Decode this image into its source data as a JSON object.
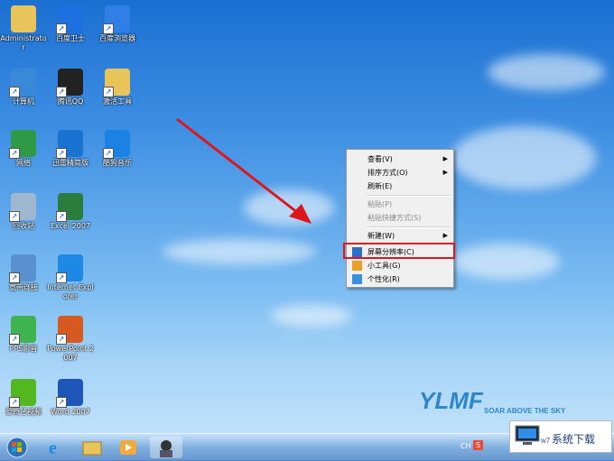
{
  "desktop": {
    "icons": [
      {
        "label": "Administrator",
        "name": "folder-user-icon",
        "color": "#e9c45a"
      },
      {
        "label": "百度卫士",
        "name": "shield-icon",
        "color": "#1e6fe0"
      },
      {
        "label": "百度浏览器",
        "name": "browser-icon",
        "color": "#2f7fe6"
      },
      {
        "label": "计算机",
        "name": "computer-icon",
        "color": "#3a88d8"
      },
      {
        "label": "腾讯QQ",
        "name": "qq-penguin-icon",
        "color": "#222222"
      },
      {
        "label": "激活工具",
        "name": "folder-icon",
        "color": "#e9c45a"
      },
      {
        "label": "网络",
        "name": "network-globe-icon",
        "color": "#2e9a48"
      },
      {
        "label": "迅雷精简版",
        "name": "thunder-bird-icon",
        "color": "#1a73d1"
      },
      {
        "label": "酷狗音乐",
        "name": "kugou-music-icon",
        "color": "#1a82e2"
      },
      {
        "label": "回收站",
        "name": "recycle-bin-icon",
        "color": "#9fb7cf"
      },
      {
        "label": "Excel 2007",
        "name": "excel-icon",
        "color": "#2b7d3e"
      },
      {
        "label": "宽带连接",
        "name": "broadband-connection-icon",
        "color": "#5a8fd0"
      },
      {
        "label": "Internet Explorer",
        "name": "internet-explorer-icon",
        "color": "#1e88e5"
      },
      {
        "label": "PPS影音",
        "name": "pps-player-icon",
        "color": "#3fb34f"
      },
      {
        "label": "PowerPoint 2007",
        "name": "powerpoint-icon",
        "color": "#d65a1f"
      },
      {
        "label": "爱奇艺视频",
        "name": "iqiyi-icon",
        "color": "#53b81f"
      },
      {
        "label": "Word 2007",
        "name": "word-icon",
        "color": "#1e56b8"
      }
    ]
  },
  "context_menu": {
    "items": [
      {
        "label": "查看(V)",
        "submenu": true,
        "disabled": false
      },
      {
        "label": "排序方式(O)",
        "submenu": true,
        "disabled": false
      },
      {
        "label": "刷新(E)",
        "submenu": false,
        "disabled": false
      },
      {
        "label": "粘贴(P)",
        "submenu": false,
        "disabled": true
      },
      {
        "label": "粘贴快捷方式(S)",
        "submenu": false,
        "disabled": true
      },
      {
        "label": "新建(W)",
        "submenu": true,
        "disabled": false
      },
      {
        "label": "屏幕分辨率(C)",
        "submenu": false,
        "disabled": false,
        "icon": "screen-resolution-icon"
      },
      {
        "label": "小工具(G)",
        "submenu": false,
        "disabled": false,
        "icon": "gadgets-icon"
      },
      {
        "label": "个性化(R)",
        "submenu": false,
        "disabled": false,
        "icon": "personalize-icon"
      }
    ],
    "highlight_color": "#e0151c"
  },
  "wallpaper": {
    "logo_text": "YLMF",
    "slogan": "SOAR ABOVE THE SKY"
  },
  "taskbar": {
    "pinned": [
      "start-orb-icon",
      "internet-explorer-icon",
      "windows-explorer-icon",
      "media-player-icon",
      "user-avatar-icon"
    ],
    "tray": {
      "lang": "CH"
    }
  },
  "watermark": {
    "text": "系统下载",
    "prefix": "w7"
  }
}
